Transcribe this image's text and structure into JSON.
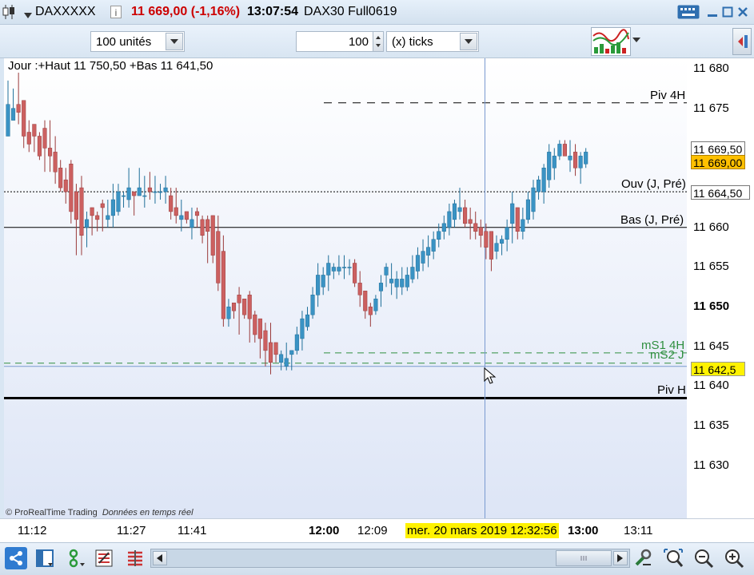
{
  "title_bar": {
    "symbol": "DAXXXXX",
    "price_change": "11 669,00 (-1,16%)",
    "time": "13:07:54",
    "instrument": "DAX30 Full0619"
  },
  "toolbar": {
    "units_select": "100 unités",
    "tick_count": "100",
    "tick_type_select": "(x) ticks"
  },
  "chart_info": {
    "range_text": "Jour :+Haut 11 750,50 +Bas 11 641,50",
    "copyright": "© ProRealTime Trading",
    "realtime_note": "Données en temps réel"
  },
  "levels": {
    "piv_4h": "Piv 4H",
    "ouv": "Ouv (J, Pré)",
    "bas": "Bas (J, Pré)",
    "ms1": "mS1 4H",
    "ms2": "mS2 J",
    "piv_h": "Piv H"
  },
  "y_axis": {
    "labels": [
      "11 680",
      "11 675",
      "11 660",
      "11 655",
      "11 650",
      "11 645",
      "11 640",
      "11 635",
      "11 630"
    ],
    "tag_high": "11 669,50",
    "tag_last": "11 669,00",
    "tag_ouv": "11 664,50",
    "tag_cursor": "11 642,5"
  },
  "x_axis": {
    "labels": [
      "11:12",
      "11:27",
      "11:41",
      "12:00",
      "12:09",
      "13:00",
      "13:11"
    ],
    "cursor_label": "mer. 20 mars 2019 12:32:56"
  },
  "colors": {
    "up": "#3a93c4",
    "down": "#cc6060",
    "level_dark": "#000000",
    "level_green": "#2f8f3f",
    "crosshair": "#7a9ad0",
    "tag_yellow": "#fff200"
  },
  "icons": [
    "candlestick-icon",
    "grid-icon",
    "share-icon",
    "layout-icon",
    "indicator-icon",
    "list-icon",
    "bars-icon",
    "tools-icon",
    "zoom-fit-icon",
    "zoom-out-icon",
    "zoom-in-icon"
  ],
  "chart_data": {
    "type": "candlestick",
    "ylim": [
      11625,
      11682.5
    ],
    "series": [
      {
        "o": 11671.5,
        "h": 11678.5,
        "l": 11674.0,
        "c": 11675.5
      },
      {
        "o": 11673.5,
        "h": 11677.5,
        "l": 11673.5,
        "c": 11675.0
      },
      {
        "o": 11675.5,
        "h": 11679.5,
        "l": 11673.0,
        "c": 11674.5
      },
      {
        "o": 11676.0,
        "h": 11676.0,
        "l": 11670.0,
        "c": 11671.5
      },
      {
        "o": 11672.0,
        "h": 11673.5,
        "l": 11669.5,
        "c": 11670.5
      },
      {
        "o": 11673.0,
        "h": 11673.0,
        "l": 11669.5,
        "c": 11671.5
      },
      {
        "o": 11671.5,
        "h": 11672.0,
        "l": 11668.5,
        "c": 11669.0
      },
      {
        "o": 11672.5,
        "h": 11673.5,
        "l": 11667.0,
        "c": 11670.0
      },
      {
        "o": 11670.0,
        "h": 11673.5,
        "l": 11667.0,
        "c": 11669.0
      },
      {
        "o": 11669.5,
        "h": 11671.5,
        "l": 11665.5,
        "c": 11667.0
      },
      {
        "o": 11667.5,
        "h": 11668.5,
        "l": 11664.5,
        "c": 11665.0
      },
      {
        "o": 11666.0,
        "h": 11667.5,
        "l": 11663.0,
        "c": 11664.5
      },
      {
        "o": 11668.0,
        "h": 11668.5,
        "l": 11660.5,
        "c": 11662.0
      },
      {
        "o": 11664.5,
        "h": 11665.5,
        "l": 11656.5,
        "c": 11661.0
      },
      {
        "o": 11665.0,
        "h": 11666.5,
        "l": 11656.5,
        "c": 11659.0
      },
      {
        "o": 11660.0,
        "h": 11662.0,
        "l": 11657.5,
        "c": 11661.0
      },
      {
        "o": 11662.5,
        "h": 11662.5,
        "l": 11659.0,
        "c": 11661.5
      },
      {
        "o": 11661.5,
        "h": 11662.0,
        "l": 11659.5,
        "c": 11661.0
      },
      {
        "o": 11663.0,
        "h": 11663.5,
        "l": 11659.5,
        "c": 11662.5
      },
      {
        "o": 11661.0,
        "h": 11663.5,
        "l": 11660.0,
        "c": 11661.5
      },
      {
        "o": 11661.5,
        "h": 11665.5,
        "l": 11660.0,
        "c": 11663.5
      },
      {
        "o": 11662.0,
        "h": 11665.5,
        "l": 11661.5,
        "c": 11664.5
      },
      {
        "o": 11664.0,
        "h": 11664.5,
        "l": 11662.5,
        "c": 11664.0
      },
      {
        "o": 11663.5,
        "h": 11667.5,
        "l": 11662.5,
        "c": 11665.0
      },
      {
        "o": 11664.5,
        "h": 11664.5,
        "l": 11661.5,
        "c": 11664.0
      },
      {
        "o": 11664.0,
        "h": 11667.5,
        "l": 11664.0,
        "c": 11665.0
      },
      {
        "o": 11664.0,
        "h": 11666.5,
        "l": 11662.5,
        "c": 11664.0
      },
      {
        "o": 11665.0,
        "h": 11667.0,
        "l": 11663.5,
        "c": 11664.5
      },
      {
        "o": 11664.5,
        "h": 11666.5,
        "l": 11663.0,
        "c": 11664.5
      },
      {
        "o": 11664.5,
        "h": 11665.5,
        "l": 11663.5,
        "c": 11664.5
      },
      {
        "o": 11664.5,
        "h": 11666.5,
        "l": 11663.0,
        "c": 11665.0
      },
      {
        "o": 11664.0,
        "h": 11665.0,
        "l": 11661.0,
        "c": 11662.0
      },
      {
        "o": 11662.5,
        "h": 11665.0,
        "l": 11660.5,
        "c": 11661.5
      },
      {
        "o": 11661.0,
        "h": 11663.5,
        "l": 11659.5,
        "c": 11661.5
      },
      {
        "o": 11662.0,
        "h": 11662.0,
        "l": 11660.5,
        "c": 11661.0
      },
      {
        "o": 11660.0,
        "h": 11662.5,
        "l": 11658.5,
        "c": 11661.0
      },
      {
        "o": 11662.0,
        "h": 11662.5,
        "l": 11660.0,
        "c": 11661.5
      },
      {
        "o": 11661.0,
        "h": 11661.5,
        "l": 11658.0,
        "c": 11659.0
      },
      {
        "o": 11661.0,
        "h": 11661.5,
        "l": 11655.5,
        "c": 11659.5
      },
      {
        "o": 11661.5,
        "h": 11661.5,
        "l": 11655.5,
        "c": 11656.5
      },
      {
        "o": 11659.5,
        "h": 11661.5,
        "l": 11652.0,
        "c": 11653.0
      },
      {
        "o": 11657.0,
        "h": 11659.0,
        "l": 11647.5,
        "c": 11648.5
      },
      {
        "o": 11648.5,
        "h": 11651.0,
        "l": 11647.5,
        "c": 11650.0
      },
      {
        "o": 11650.5,
        "h": 11650.5,
        "l": 11648.5,
        "c": 11649.5
      },
      {
        "o": 11651.5,
        "h": 11652.5,
        "l": 11646.5,
        "c": 11650.5
      },
      {
        "o": 11651.0,
        "h": 11651.0,
        "l": 11648.5,
        "c": 11649.0
      },
      {
        "o": 11651.5,
        "h": 11652.0,
        "l": 11645.5,
        "c": 11648.5
      },
      {
        "o": 11649.0,
        "h": 11649.5,
        "l": 11645.5,
        "c": 11646.5
      },
      {
        "o": 11648.5,
        "h": 11648.5,
        "l": 11643.5,
        "c": 11646.0
      },
      {
        "o": 11647.0,
        "h": 11648.0,
        "l": 11642.5,
        "c": 11644.5
      },
      {
        "o": 11645.5,
        "h": 11648.0,
        "l": 11641.5,
        "c": 11643.0
      },
      {
        "o": 11645.5,
        "h": 11645.5,
        "l": 11643.0,
        "c": 11644.0
      },
      {
        "o": 11643.0,
        "h": 11644.5,
        "l": 11642.0,
        "c": 11644.0
      },
      {
        "o": 11642.5,
        "h": 11645.5,
        "l": 11642.0,
        "c": 11643.5
      },
      {
        "o": 11644.0,
        "h": 11644.5,
        "l": 11642.0,
        "c": 11644.5
      },
      {
        "o": 11644.5,
        "h": 11647.5,
        "l": 11644.0,
        "c": 11646.5
      },
      {
        "o": 11646.0,
        "h": 11649.5,
        "l": 11644.5,
        "c": 11648.5
      },
      {
        "o": 11647.5,
        "h": 11650.0,
        "l": 11647.0,
        "c": 11649.0
      },
      {
        "o": 11649.0,
        "h": 11652.5,
        "l": 11648.5,
        "c": 11651.5
      },
      {
        "o": 11651.5,
        "h": 11655.5,
        "l": 11650.0,
        "c": 11654.0
      },
      {
        "o": 11652.5,
        "h": 11655.0,
        "l": 11651.5,
        "c": 11654.0
      },
      {
        "o": 11654.0,
        "h": 11656.5,
        "l": 11652.0,
        "c": 11655.5
      },
      {
        "o": 11654.5,
        "h": 11655.5,
        "l": 11653.5,
        "c": 11655.0
      },
      {
        "o": 11654.5,
        "h": 11656.5,
        "l": 11654.0,
        "c": 11655.0
      },
      {
        "o": 11655.0,
        "h": 11656.5,
        "l": 11653.5,
        "c": 11655.0
      },
      {
        "o": 11655.0,
        "h": 11656.0,
        "l": 11654.0,
        "c": 11655.0
      },
      {
        "o": 11655.5,
        "h": 11656.0,
        "l": 11652.5,
        "c": 11653.0
      },
      {
        "o": 11653.0,
        "h": 11654.5,
        "l": 11650.0,
        "c": 11651.5
      },
      {
        "o": 11652.0,
        "h": 11652.0,
        "l": 11648.5,
        "c": 11649.5
      },
      {
        "o": 11650.0,
        "h": 11650.5,
        "l": 11647.5,
        "c": 11649.0
      },
      {
        "o": 11649.5,
        "h": 11651.5,
        "l": 11649.0,
        "c": 11651.0
      },
      {
        "o": 11652.0,
        "h": 11654.0,
        "l": 11650.0,
        "c": 11653.0
      },
      {
        "o": 11654.0,
        "h": 11655.5,
        "l": 11652.5,
        "c": 11655.0
      },
      {
        "o": 11653.0,
        "h": 11655.5,
        "l": 11651.5,
        "c": 11653.5
      },
      {
        "o": 11652.5,
        "h": 11654.5,
        "l": 11651.0,
        "c": 11653.5
      },
      {
        "o": 11652.5,
        "h": 11655.0,
        "l": 11651.5,
        "c": 11653.5
      },
      {
        "o": 11652.5,
        "h": 11655.0,
        "l": 11652.0,
        "c": 11654.0
      },
      {
        "o": 11653.5,
        "h": 11656.5,
        "l": 11653.0,
        "c": 11655.0
      },
      {
        "o": 11654.5,
        "h": 11657.5,
        "l": 11653.5,
        "c": 11656.5
      },
      {
        "o": 11655.5,
        "h": 11658.5,
        "l": 11654.5,
        "c": 11657.0
      },
      {
        "o": 11656.5,
        "h": 11659.0,
        "l": 11655.0,
        "c": 11657.5
      },
      {
        "o": 11657.0,
        "h": 11659.5,
        "l": 11656.0,
        "c": 11658.5
      },
      {
        "o": 11658.5,
        "h": 11660.5,
        "l": 11657.5,
        "c": 11659.5
      },
      {
        "o": 11659.5,
        "h": 11661.5,
        "l": 11658.5,
        "c": 11660.5
      },
      {
        "o": 11660.0,
        "h": 11663.0,
        "l": 11659.0,
        "c": 11662.0
      },
      {
        "o": 11661.0,
        "h": 11663.5,
        "l": 11660.0,
        "c": 11663.0
      },
      {
        "o": 11662.0,
        "h": 11665.0,
        "l": 11661.0,
        "c": 11662.5
      },
      {
        "o": 11662.5,
        "h": 11663.5,
        "l": 11660.0,
        "c": 11660.5
      },
      {
        "o": 11661.0,
        "h": 11662.5,
        "l": 11658.5,
        "c": 11660.5
      },
      {
        "o": 11660.5,
        "h": 11662.0,
        "l": 11658.5,
        "c": 11659.5
      },
      {
        "o": 11660.0,
        "h": 11661.0,
        "l": 11657.5,
        "c": 11659.0
      },
      {
        "o": 11659.5,
        "h": 11660.5,
        "l": 11656.0,
        "c": 11657.5
      },
      {
        "o": 11659.5,
        "h": 11659.5,
        "l": 11654.5,
        "c": 11656.0
      },
      {
        "o": 11657.0,
        "h": 11659.0,
        "l": 11656.0,
        "c": 11658.0
      },
      {
        "o": 11658.0,
        "h": 11659.0,
        "l": 11656.5,
        "c": 11658.5
      },
      {
        "o": 11658.5,
        "h": 11661.0,
        "l": 11657.0,
        "c": 11660.0
      },
      {
        "o": 11660.5,
        "h": 11664.5,
        "l": 11658.0,
        "c": 11663.0
      },
      {
        "o": 11662.5,
        "h": 11662.5,
        "l": 11658.5,
        "c": 11659.5
      },
      {
        "o": 11659.5,
        "h": 11662.5,
        "l": 11658.5,
        "c": 11661.0
      },
      {
        "o": 11661.0,
        "h": 11664.5,
        "l": 11660.5,
        "c": 11663.5
      },
      {
        "o": 11662.0,
        "h": 11666.0,
        "l": 11661.0,
        "c": 11665.0
      },
      {
        "o": 11664.5,
        "h": 11666.5,
        "l": 11663.5,
        "c": 11666.0
      },
      {
        "o": 11664.5,
        "h": 11668.0,
        "l": 11663.0,
        "c": 11667.5
      },
      {
        "o": 11666.0,
        "h": 11670.5,
        "l": 11665.0,
        "c": 11669.5
      },
      {
        "o": 11667.5,
        "h": 11670.0,
        "l": 11666.0,
        "c": 11669.0
      },
      {
        "o": 11669.0,
        "h": 11671.0,
        "l": 11668.5,
        "c": 11670.5
      },
      {
        "o": 11670.5,
        "h": 11671.0,
        "l": 11669.0,
        "c": 11669.0
      },
      {
        "o": 11668.5,
        "h": 11671.0,
        "l": 11667.0,
        "c": 11669.0
      },
      {
        "o": 11669.5,
        "h": 11670.5,
        "l": 11666.5,
        "c": 11667.5
      },
      {
        "o": 11667.5,
        "h": 11669.5,
        "l": 11665.5,
        "c": 11669.0
      },
      {
        "o": 11668.0,
        "h": 11670.0,
        "l": 11667.5,
        "c": 11669.5
      }
    ]
  }
}
